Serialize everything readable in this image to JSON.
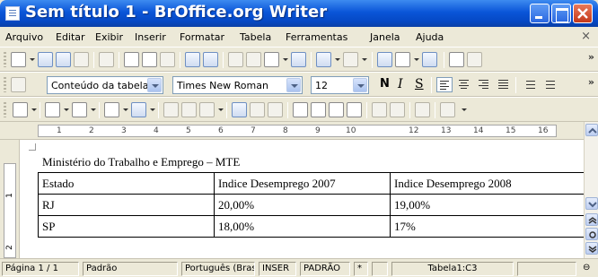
{
  "window": {
    "title": "Sem título 1 - BrOffice.org Writer"
  },
  "menu": {
    "items": [
      "Arquivo",
      "Editar",
      "Exibir",
      "Inserir",
      "Formatar",
      "Tabela",
      "Ferramentas",
      "Janela",
      "Ajuda"
    ],
    "close_glyph": "×"
  },
  "toolbar2": {
    "paragraph_style": "Conteúdo da tabela",
    "font_name": "Times New Roman",
    "font_size": "12",
    "bold": "N",
    "italic": "I",
    "underline": "S"
  },
  "ruler": {
    "ticks": [
      "1",
      "2",
      "3",
      "4",
      "5",
      "6",
      "7",
      "8",
      "9",
      "10",
      "12",
      "13",
      "14",
      "15",
      "16"
    ]
  },
  "vruler": {
    "ticks": [
      "1",
      "2"
    ]
  },
  "document": {
    "heading": "Ministério do Trabalho e Emprego – MTE",
    "columns": [
      "Estado",
      "Indice Desemprego 2007",
      "Indice Desemprego 2008"
    ],
    "rows": [
      [
        "RJ",
        "20,00%",
        "19,00%"
      ],
      [
        "SP",
        "18,00%",
        "17%"
      ]
    ]
  },
  "statusbar": {
    "page": "Página 1 / 1",
    "style": "Padrão",
    "language": "Português (Brasil)",
    "insert_mode": "INSER",
    "selection_mode": "PADRÃO",
    "modified": "*",
    "cell": "Tabela1:C3"
  },
  "icons": {
    "title": "document-icon",
    "minimize": "minimize-icon",
    "maximize": "maximize-icon",
    "close": "close-icon"
  }
}
